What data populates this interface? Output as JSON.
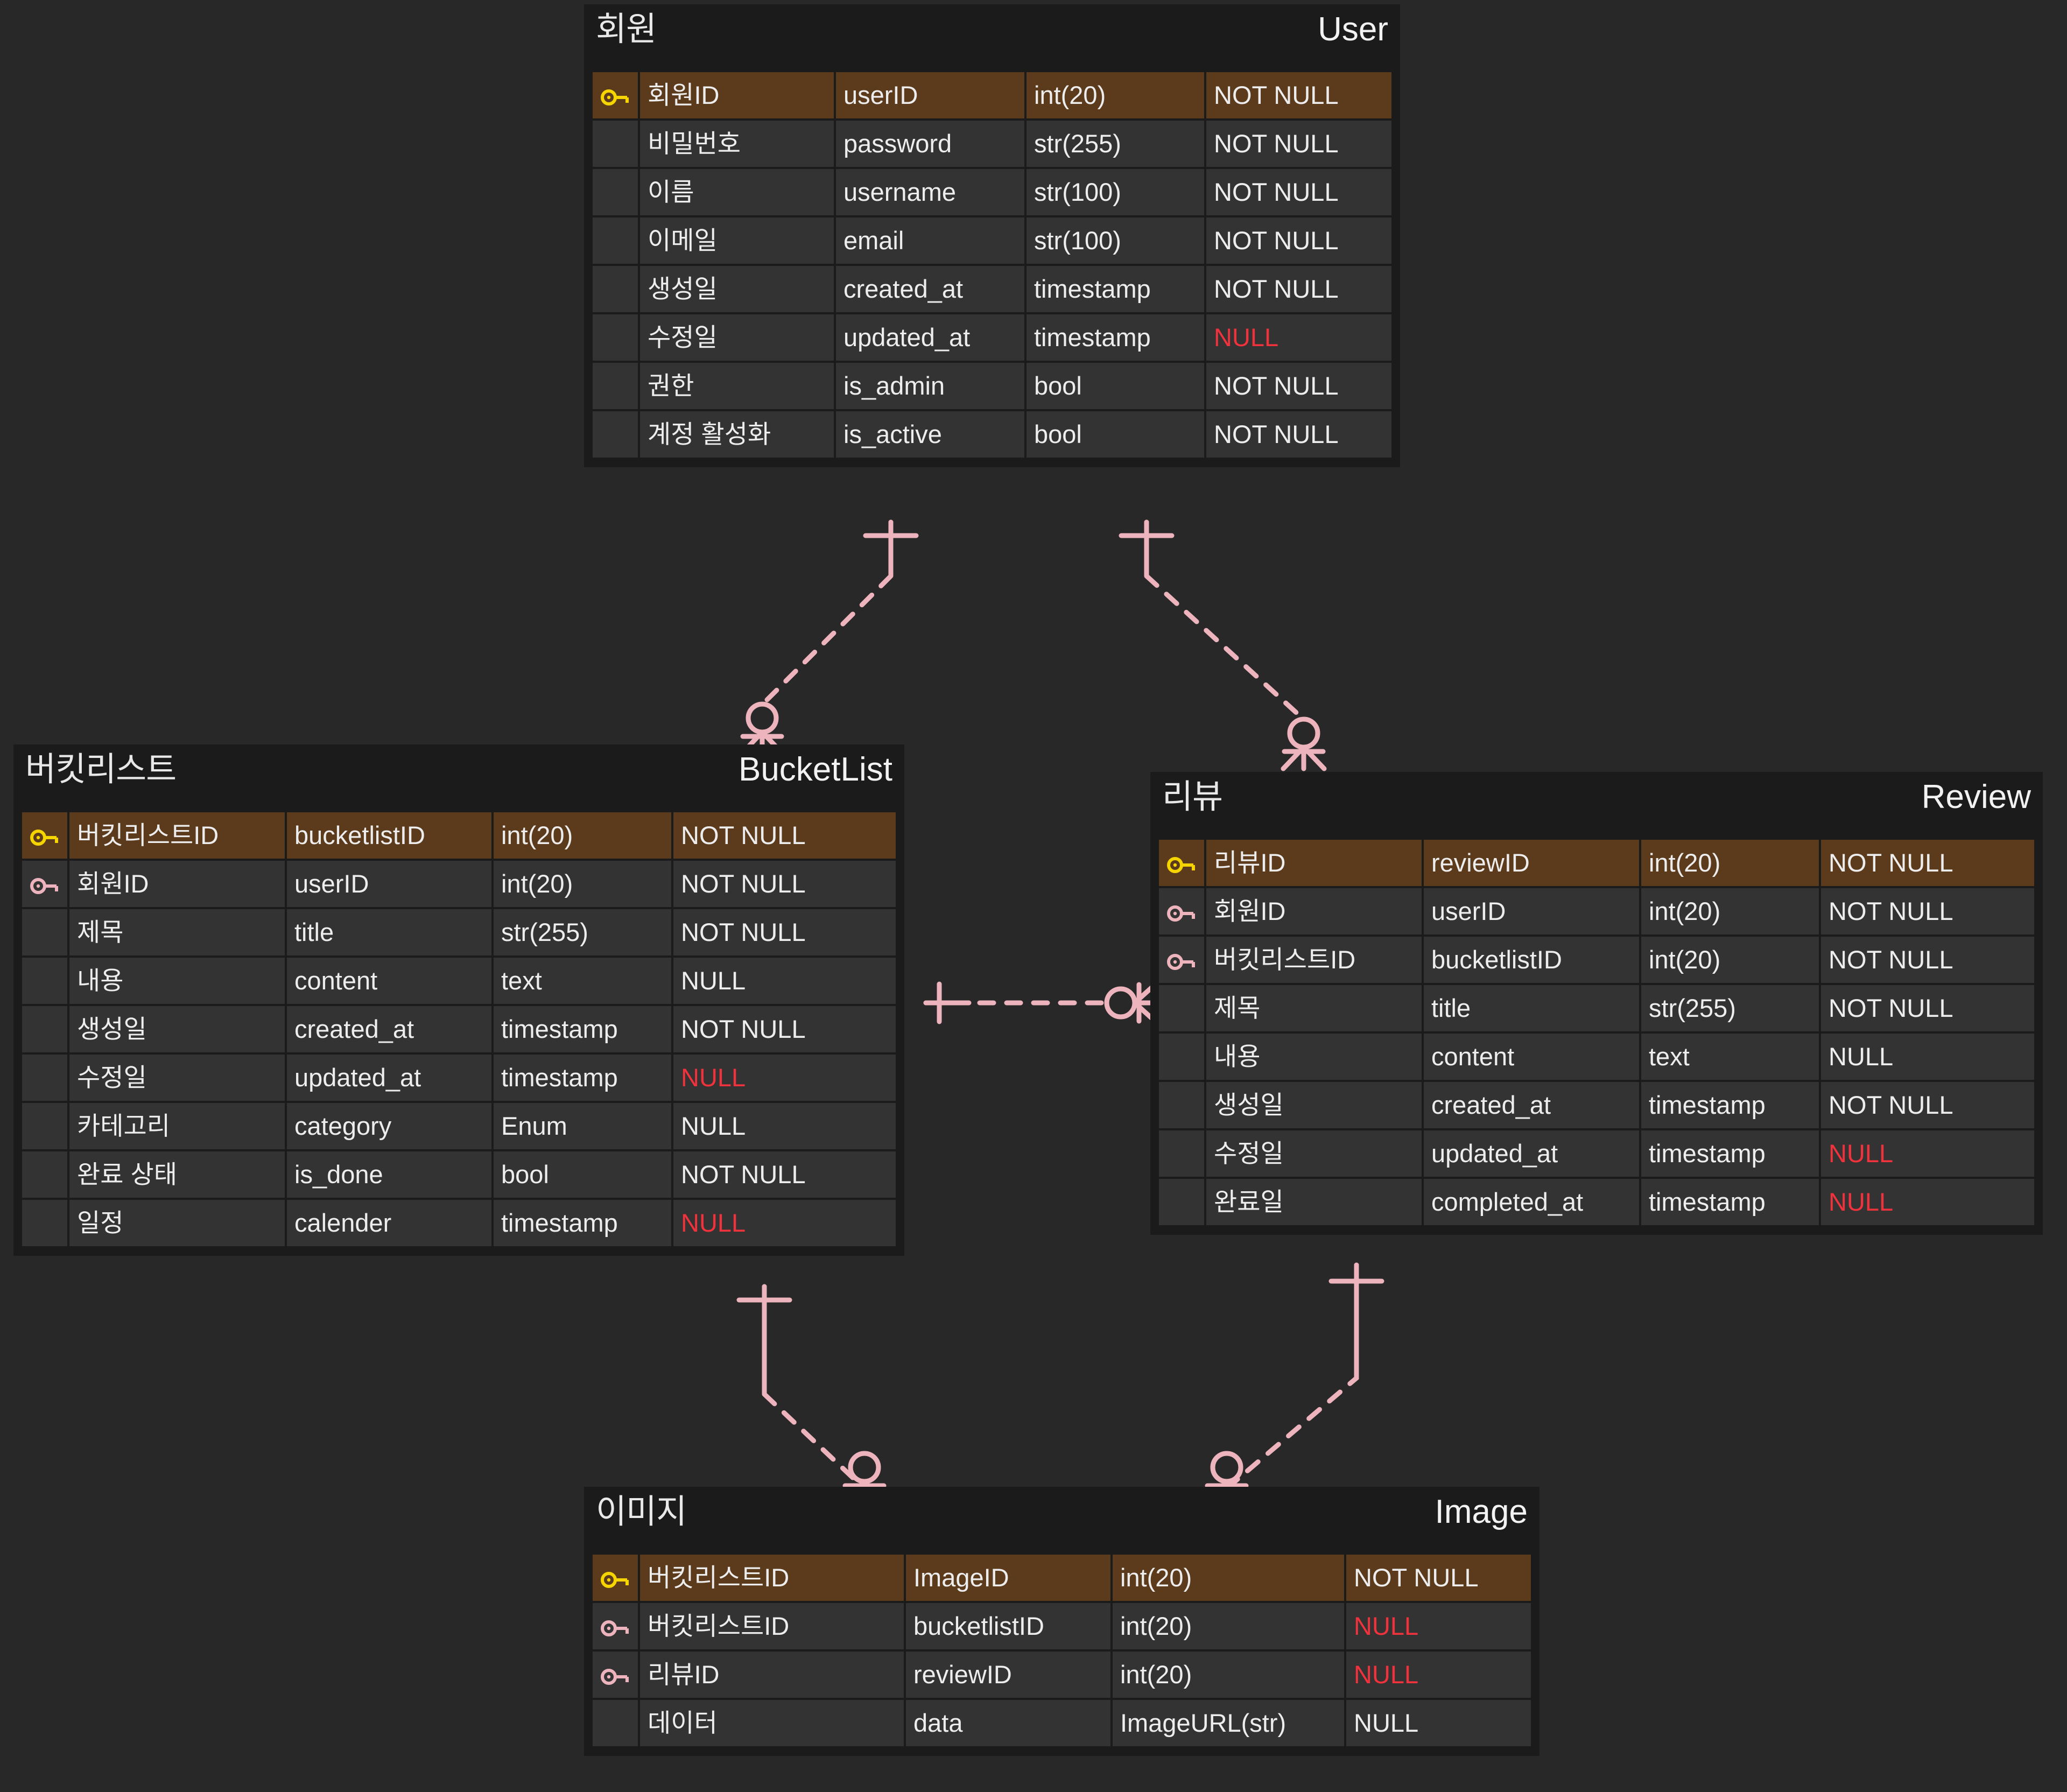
{
  "diagram": {
    "kind": "erd",
    "background": "#282828",
    "relationship_color": "#eeb4bd",
    "pk_row_color": "#5c3b1c",
    "row_color": "#333333",
    "null_color": "#f0323c"
  },
  "entities": [
    {
      "id": "user",
      "title_ko": "회원",
      "title_en": "User",
      "columns": [
        "key",
        "label_ko",
        "name",
        "type",
        "nullable"
      ],
      "rows": [
        {
          "key": "pk",
          "label_ko": "회원ID",
          "name": "userID",
          "type": "int(20)",
          "nullable": "NOT NULL",
          "null_red": false
        },
        {
          "key": "",
          "label_ko": "비밀번호",
          "name": "password",
          "type": "str(255)",
          "nullable": "NOT NULL",
          "null_red": false
        },
        {
          "key": "",
          "label_ko": "이름",
          "name": "username",
          "type": "str(100)",
          "nullable": "NOT NULL",
          "null_red": false
        },
        {
          "key": "",
          "label_ko": "이메일",
          "name": "email",
          "type": "str(100)",
          "nullable": "NOT NULL",
          "null_red": false
        },
        {
          "key": "",
          "label_ko": "생성일",
          "name": "created_at",
          "type": "timestamp",
          "nullable": "NOT NULL",
          "null_red": false
        },
        {
          "key": "",
          "label_ko": "수정일",
          "name": "updated_at",
          "type": "timestamp",
          "nullable": "NULL",
          "null_red": true
        },
        {
          "key": "",
          "label_ko": "권한",
          "name": "is_admin",
          "type": "bool",
          "nullable": "NOT NULL",
          "null_red": false
        },
        {
          "key": "",
          "label_ko": "계정 활성화",
          "name": "is_active",
          "type": "bool",
          "nullable": "NOT NULL",
          "null_red": false
        }
      ]
    },
    {
      "id": "bucketlist",
      "title_ko": "버킷리스트",
      "title_en": "BucketList",
      "columns": [
        "key",
        "label_ko",
        "name",
        "type",
        "nullable"
      ],
      "rows": [
        {
          "key": "pk",
          "label_ko": "버킷리스트ID",
          "name": "bucketlistID",
          "type": "int(20)",
          "nullable": "NOT NULL",
          "null_red": false
        },
        {
          "key": "fk",
          "label_ko": "회원ID",
          "name": "userID",
          "type": "int(20)",
          "nullable": "NOT NULL",
          "null_red": false
        },
        {
          "key": "",
          "label_ko": "제목",
          "name": "title",
          "type": "str(255)",
          "nullable": "NOT NULL",
          "null_red": false
        },
        {
          "key": "",
          "label_ko": "내용",
          "name": "content",
          "type": "text",
          "nullable": "NULL",
          "null_red": false
        },
        {
          "key": "",
          "label_ko": "생성일",
          "name": "created_at",
          "type": "timestamp",
          "nullable": "NOT NULL",
          "null_red": false
        },
        {
          "key": "",
          "label_ko": "수정일",
          "name": "updated_at",
          "type": "timestamp",
          "nullable": "NULL",
          "null_red": true
        },
        {
          "key": "",
          "label_ko": "카테고리",
          "name": "category",
          "type": "Enum",
          "nullable": "NULL",
          "null_red": false
        },
        {
          "key": "",
          "label_ko": "완료 상태",
          "name": "is_done",
          "type": "bool",
          "nullable": "NOT NULL",
          "null_red": false
        },
        {
          "key": "",
          "label_ko": "일정",
          "name": "calender",
          "type": "timestamp",
          "nullable": "NULL",
          "null_red": true
        }
      ]
    },
    {
      "id": "review",
      "title_ko": "리뷰",
      "title_en": "Review",
      "columns": [
        "key",
        "label_ko",
        "name",
        "type",
        "nullable"
      ],
      "rows": [
        {
          "key": "pk",
          "label_ko": "리뷰ID",
          "name": "reviewID",
          "type": "int(20)",
          "nullable": "NOT NULL",
          "null_red": false
        },
        {
          "key": "fk",
          "label_ko": "회원ID",
          "name": "userID",
          "type": "int(20)",
          "nullable": "NOT NULL",
          "null_red": false
        },
        {
          "key": "fk",
          "label_ko": "버킷리스트ID",
          "name": "bucketlistID",
          "type": "int(20)",
          "nullable": "NOT NULL",
          "null_red": false
        },
        {
          "key": "",
          "label_ko": "제목",
          "name": "title",
          "type": "str(255)",
          "nullable": "NOT NULL",
          "null_red": false
        },
        {
          "key": "",
          "label_ko": "내용",
          "name": "content",
          "type": "text",
          "nullable": "NULL",
          "null_red": false
        },
        {
          "key": "",
          "label_ko": "생성일",
          "name": "created_at",
          "type": "timestamp",
          "nullable": "NOT NULL",
          "null_red": false
        },
        {
          "key": "",
          "label_ko": "수정일",
          "name": "updated_at",
          "type": "timestamp",
          "nullable": "NULL",
          "null_red": true
        },
        {
          "key": "",
          "label_ko": "완료일",
          "name": "completed_at",
          "type": "timestamp",
          "nullable": "NULL",
          "null_red": true
        }
      ]
    },
    {
      "id": "image",
      "title_ko": "이미지",
      "title_en": "Image",
      "columns": [
        "key",
        "label_ko",
        "name",
        "type",
        "nullable"
      ],
      "rows": [
        {
          "key": "pk",
          "label_ko": "버킷리스트ID",
          "name": "ImageID",
          "type": "int(20)",
          "nullable": "NOT NULL",
          "null_red": false
        },
        {
          "key": "fk",
          "label_ko": "버킷리스트ID",
          "name": "bucketlistID",
          "type": "int(20)",
          "nullable": "NULL",
          "null_red": true
        },
        {
          "key": "fk",
          "label_ko": "리뷰ID",
          "name": "reviewID",
          "type": "int(20)",
          "nullable": "NULL",
          "null_red": true
        },
        {
          "key": "",
          "label_ko": "데이터",
          "name": "data",
          "type": "ImageURL(str)",
          "nullable": "NULL",
          "null_red": false
        }
      ]
    }
  ],
  "relationships": [
    {
      "id": "user-bucketlist",
      "from": "User",
      "to": "BucketList",
      "from_card": "one",
      "to_card": "zero-or-many"
    },
    {
      "id": "user-review",
      "from": "User",
      "to": "Review",
      "from_card": "one",
      "to_card": "zero-or-many"
    },
    {
      "id": "bucketlist-review",
      "from": "BucketList",
      "to": "Review",
      "from_card": "one",
      "to_card": "zero-or-many"
    },
    {
      "id": "bucketlist-image",
      "from": "BucketList",
      "to": "Image",
      "from_card": "one",
      "to_card": "zero-or-many"
    },
    {
      "id": "review-image",
      "from": "Review",
      "to": "Image",
      "from_card": "one",
      "to_card": "zero-or-many"
    }
  ],
  "icons": {
    "pk": "primary-key-icon",
    "fk": "foreign-key-icon",
    "one": "crowsfoot-one-tick",
    "many": "crowsfoot-zero-or-many"
  }
}
